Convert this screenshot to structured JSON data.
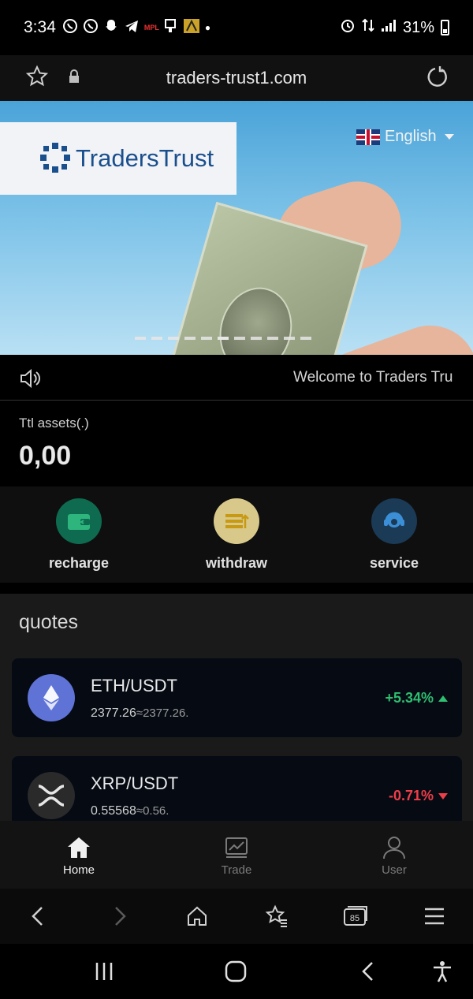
{
  "status_bar": {
    "time": "3:34",
    "battery": "31%",
    "notification_icons": [
      "whatsapp-icon",
      "whatsapp-icon",
      "snapchat-icon",
      "telegram-icon",
      "mpl-icon",
      "app-icon",
      "app-icon",
      "dot-icon"
    ],
    "mpl_text": "MPL"
  },
  "browser": {
    "url": "traders-trust1.com"
  },
  "banner": {
    "brand": "TradersTrust",
    "language": "English",
    "slide_count": 11,
    "active_slide": 5
  },
  "marquee": {
    "text": "Welcome to Traders Tru"
  },
  "assets": {
    "label": "Ttl assets(.)",
    "value": "0,00"
  },
  "actions": [
    {
      "label": "recharge",
      "icon": "wallet-icon",
      "color": "#0e6b4f"
    },
    {
      "label": "withdraw",
      "icon": "withdraw-icon",
      "color": "#d8c98a"
    },
    {
      "label": "service",
      "icon": "headset-icon",
      "color": "#1b3a55"
    }
  ],
  "quotes": {
    "title": "quotes",
    "items": [
      {
        "pair": "ETH/USDT",
        "price": "2377.26",
        "approx": "≈2377.26.",
        "change": "+5.34%",
        "direction": "up",
        "icon": "ethereum-icon"
      },
      {
        "pair": "XRP/USDT",
        "price": "0.55568",
        "approx": "≈0.56.",
        "change": "-0.71%",
        "direction": "down",
        "icon": "xrp-icon"
      }
    ]
  },
  "tabbar": [
    {
      "label": "Home",
      "icon": "home-icon",
      "active": true
    },
    {
      "label": "Trade",
      "icon": "chart-icon",
      "active": false
    },
    {
      "label": "User",
      "icon": "user-icon",
      "active": false
    }
  ],
  "browser_nav": {
    "tabs_count": "85"
  },
  "colors": {
    "up": "#2fbf71",
    "down": "#ef3e4a",
    "brand_blue": "#1a4f8e"
  }
}
